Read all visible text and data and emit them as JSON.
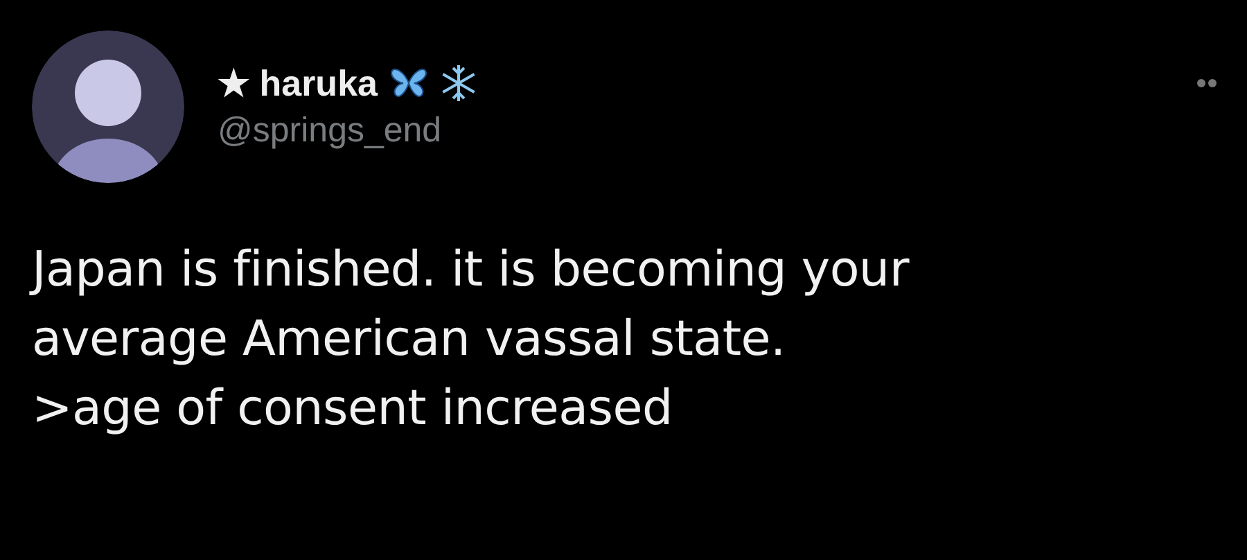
{
  "author": {
    "name": "★ haruka",
    "handle": "@springs_end"
  },
  "tweet": {
    "lines": [
      "Japan is finished. it is becoming your",
      "average American vassal state.",
      ">age of consent increased"
    ]
  }
}
